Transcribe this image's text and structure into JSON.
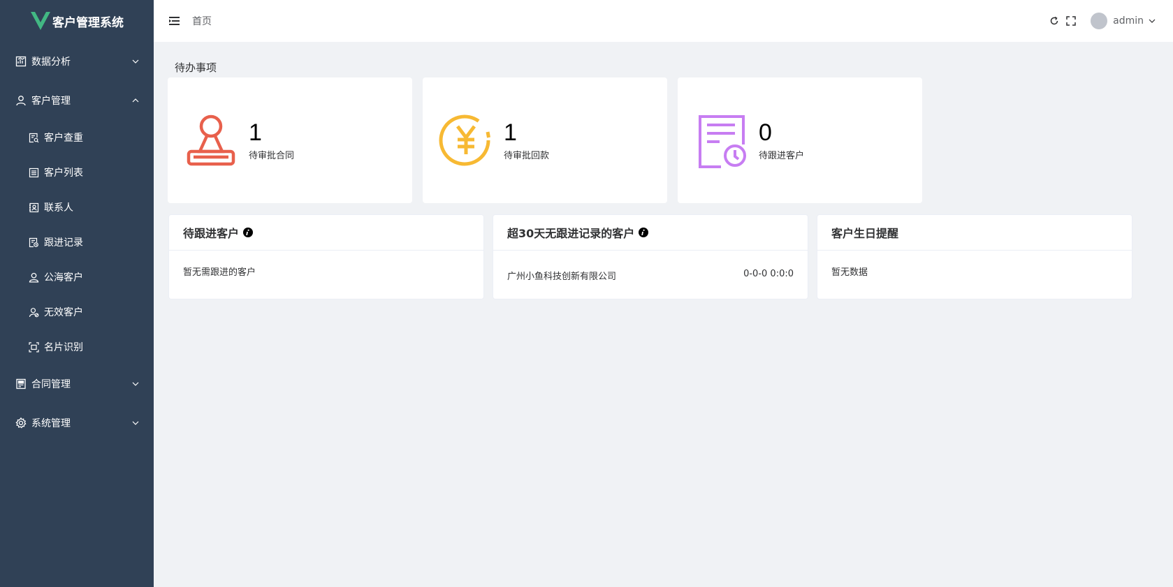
{
  "app": {
    "title": "客户管理系统"
  },
  "sidebar": {
    "menu": [
      {
        "label": "数据分析",
        "icon": "chart-icon",
        "expanded": false
      },
      {
        "label": "客户管理",
        "icon": "user-icon",
        "expanded": true,
        "children": [
          {
            "label": "客户查重",
            "icon": "search-doc-icon"
          },
          {
            "label": "客户列表",
            "icon": "list-icon"
          },
          {
            "label": "联系人",
            "icon": "contact-icon"
          },
          {
            "label": "跟进记录",
            "icon": "record-icon"
          },
          {
            "label": "公海客户",
            "icon": "person-icon"
          },
          {
            "label": "无效客户",
            "icon": "invalid-user-icon"
          },
          {
            "label": "名片识别",
            "icon": "scan-icon"
          }
        ]
      },
      {
        "label": "合同管理",
        "icon": "contract-icon",
        "expanded": false
      },
      {
        "label": "系统管理",
        "icon": "gear-icon",
        "expanded": false
      }
    ]
  },
  "header": {
    "breadcrumb": "首页",
    "username": "admin"
  },
  "todo": {
    "title": "待办事项",
    "cards": [
      {
        "count": "1",
        "label": "待审批合同",
        "icon": "stamp-icon",
        "color": "#e8604c"
      },
      {
        "count": "1",
        "label": "待审批回款",
        "icon": "yuan-icon",
        "color": "#f7b933"
      },
      {
        "count": "0",
        "label": "待跟进客户",
        "icon": "clock-document-icon",
        "color": "#c77df2"
      }
    ]
  },
  "panels": [
    {
      "title": "待跟进客户",
      "has_info": true,
      "empty_text": "暂无需跟进的客户"
    },
    {
      "title": "超30天无跟进记录的客户",
      "has_info": true,
      "rows": [
        {
          "name": "广州小鱼科技创新有限公司",
          "time": "0-0-0 0:0:0"
        }
      ]
    },
    {
      "title": "客户生日提醒",
      "has_info": false,
      "empty_text": "暂无数据"
    }
  ]
}
